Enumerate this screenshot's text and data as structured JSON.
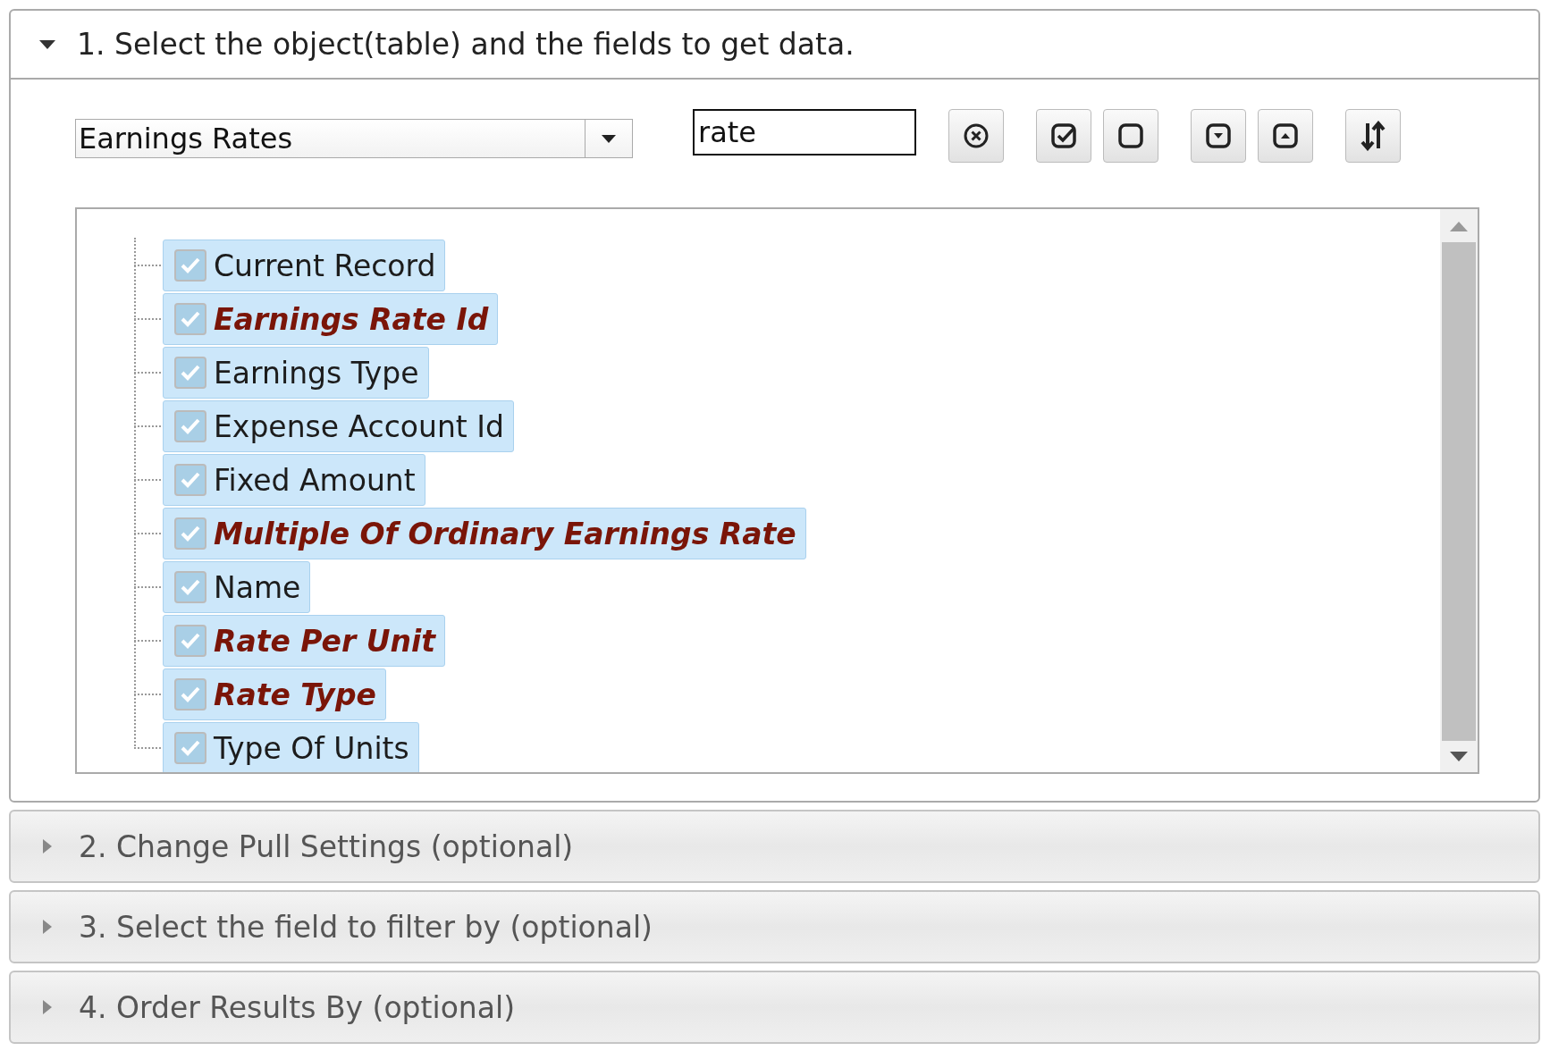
{
  "sections": [
    {
      "title": "1. Select the object(table) and the fields to get data.",
      "expanded": true
    },
    {
      "title": "2. Change Pull Settings (optional)",
      "expanded": false
    },
    {
      "title": "3. Select the field to filter by (optional)",
      "expanded": false
    },
    {
      "title": "4. Order Results By (optional)",
      "expanded": false
    }
  ],
  "object_select": {
    "value": "Earnings Rates"
  },
  "search": {
    "value": "rate"
  },
  "fields": [
    {
      "label": "Current Record",
      "checked": true,
      "emphasized": false
    },
    {
      "label": "Earnings Rate Id",
      "checked": true,
      "emphasized": true
    },
    {
      "label": "Earnings Type",
      "checked": true,
      "emphasized": false
    },
    {
      "label": "Expense Account Id",
      "checked": true,
      "emphasized": false
    },
    {
      "label": "Fixed Amount",
      "checked": true,
      "emphasized": false
    },
    {
      "label": "Multiple Of Ordinary Earnings Rate",
      "checked": true,
      "emphasized": true
    },
    {
      "label": "Name",
      "checked": true,
      "emphasized": false
    },
    {
      "label": "Rate Per Unit",
      "checked": true,
      "emphasized": true
    },
    {
      "label": "Rate Type",
      "checked": true,
      "emphasized": true
    },
    {
      "label": "Type Of Units",
      "checked": true,
      "emphasized": false
    }
  ]
}
